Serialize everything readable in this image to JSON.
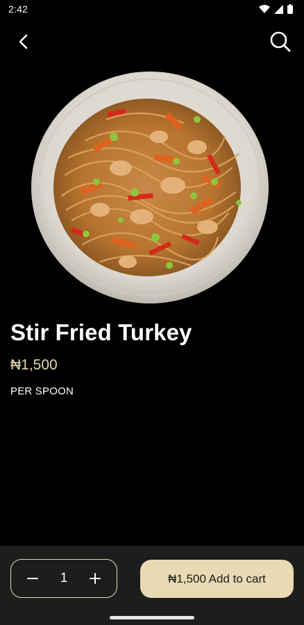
{
  "status_bar": {
    "time": "2:42",
    "icons": [
      "wifi-icon",
      "signal-icon",
      "battery-icon"
    ]
  },
  "header": {
    "back_icon": "chevron-left-icon",
    "search_icon": "search-icon"
  },
  "product": {
    "image_subject": "stir-fried-turkey-noodles-bowl",
    "name": "Stir Fried Turkey",
    "price": "₦1,500",
    "unit": "PER SPOON"
  },
  "cart_bar": {
    "quantity": "1",
    "minus_icon": "minus-icon",
    "plus_icon": "plus-icon",
    "add_button_label": "₦1,500 Add to cart"
  },
  "colors": {
    "background": "#000000",
    "accent": "#e8dab2",
    "price_text": "#e7d9b0",
    "panel": "#1d1d1e"
  }
}
